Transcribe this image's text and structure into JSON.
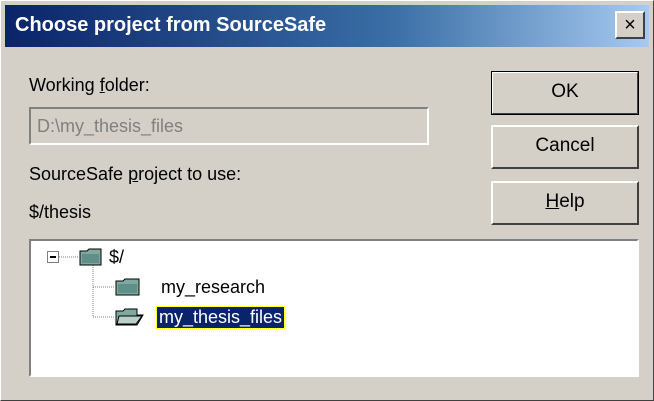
{
  "window": {
    "title": "Choose project from SourceSafe",
    "close_label": "×"
  },
  "form": {
    "working_folder_label_pre": "Working ",
    "working_folder_label_ul": "f",
    "working_folder_label_post": "older:",
    "working_folder_value": "D:\\my_thesis_files",
    "project_label_pre": "SourceSafe ",
    "project_label_ul": "p",
    "project_label_post": "roject to use:",
    "project_value": "$/thesis"
  },
  "buttons": {
    "ok": "OK",
    "cancel": "Cancel",
    "help_ul": "H",
    "help_rest": "elp"
  },
  "tree": {
    "root": "$/",
    "children": [
      {
        "label": "my_research",
        "selected": false
      },
      {
        "label": "my_thesis_files",
        "selected": true
      }
    ]
  }
}
